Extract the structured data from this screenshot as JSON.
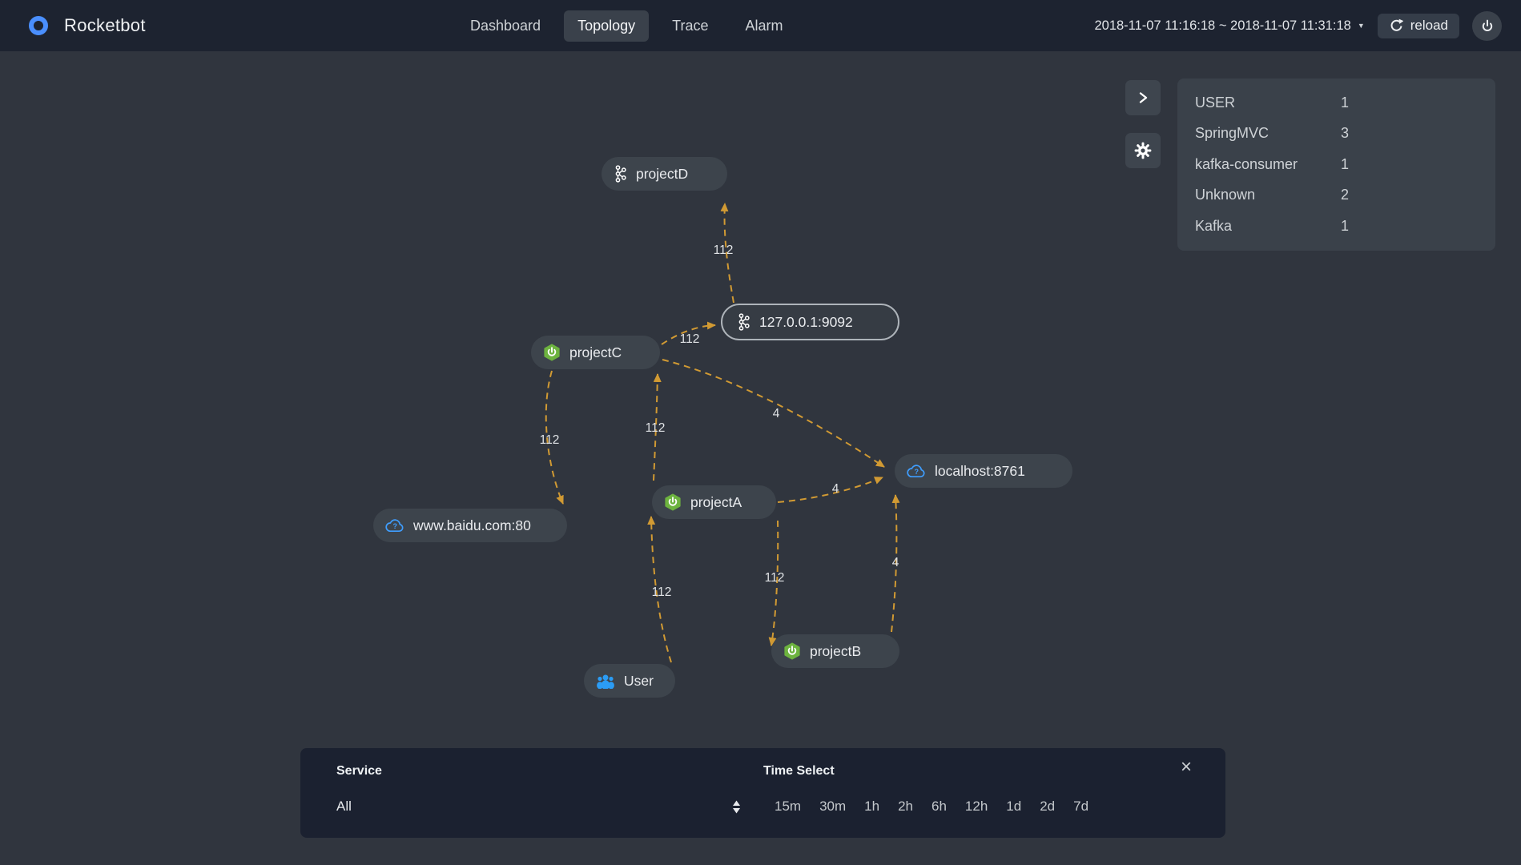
{
  "header": {
    "brand": "Rocketbot",
    "nav": [
      {
        "label": "Dashboard",
        "active": false
      },
      {
        "label": "Topology",
        "active": true
      },
      {
        "label": "Trace",
        "active": false
      },
      {
        "label": "Alarm",
        "active": false
      }
    ],
    "time_range": "2018-11-07 11:16:18 ~ 2018-11-07 11:31:18",
    "reload_label": "reload"
  },
  "legend": {
    "items": [
      {
        "label": "USER",
        "count": "1"
      },
      {
        "label": "SpringMVC",
        "count": "3"
      },
      {
        "label": "kafka-consumer",
        "count": "1"
      },
      {
        "label": "Unknown",
        "count": "2"
      },
      {
        "label": "Kafka",
        "count": "1"
      }
    ]
  },
  "topology": {
    "nodes": [
      {
        "id": "projectD",
        "label": "projectD",
        "type": "kafka-consumer",
        "icon": "kafka-icon",
        "selected": false
      },
      {
        "id": "kafka-broker",
        "label": "127.0.0.1:9092",
        "type": "Kafka",
        "icon": "kafka-icon",
        "selected": true
      },
      {
        "id": "projectC",
        "label": "projectC",
        "type": "SpringMVC",
        "icon": "springboot-icon",
        "selected": false
      },
      {
        "id": "baidu",
        "label": "www.baidu.com:80",
        "type": "Unknown",
        "icon": "cloud-icon",
        "selected": false
      },
      {
        "id": "projectA",
        "label": "projectA",
        "type": "SpringMVC",
        "icon": "springboot-icon",
        "selected": false
      },
      {
        "id": "eureka",
        "label": "localhost:8761",
        "type": "Unknown",
        "icon": "cloud-icon",
        "selected": false
      },
      {
        "id": "user",
        "label": "User",
        "type": "USER",
        "icon": "users-icon",
        "selected": false
      },
      {
        "id": "projectB",
        "label": "projectB",
        "type": "SpringMVC",
        "icon": "springboot-icon",
        "selected": false
      }
    ],
    "edges": [
      {
        "from": "127.0.0.1:9092",
        "to": "projectD",
        "label": "112"
      },
      {
        "from": "projectC",
        "to": "127.0.0.1:9092",
        "label": "112"
      },
      {
        "from": "projectC",
        "to": "www.baidu.com:80",
        "label": "112"
      },
      {
        "from": "projectC",
        "to": "localhost:8761",
        "label": "4"
      },
      {
        "from": "projectA",
        "to": "localhost:8761",
        "label": "4"
      },
      {
        "from": "projectB",
        "to": "localhost:8761",
        "label": "4"
      },
      {
        "from": "projectA",
        "to": "projectB",
        "label": "112"
      },
      {
        "from": "User",
        "to": "projectA",
        "label": "112"
      },
      {
        "from": "projectA",
        "to": "projectC",
        "label": "112"
      }
    ]
  },
  "options_panel": {
    "service_label": "Service",
    "service_value": "All",
    "time_select_label": "Time Select",
    "time_options": [
      "15m",
      "30m",
      "1h",
      "2h",
      "6h",
      "12h",
      "1d",
      "2d",
      "7d"
    ],
    "close_glyph": "×"
  },
  "colors": {
    "edge": "#d19a33",
    "brand_blue": "#4a8ffe",
    "spring_green": "#6db33f",
    "cloud_blue": "#3f9eff",
    "user_blue": "#2b9cf4"
  }
}
